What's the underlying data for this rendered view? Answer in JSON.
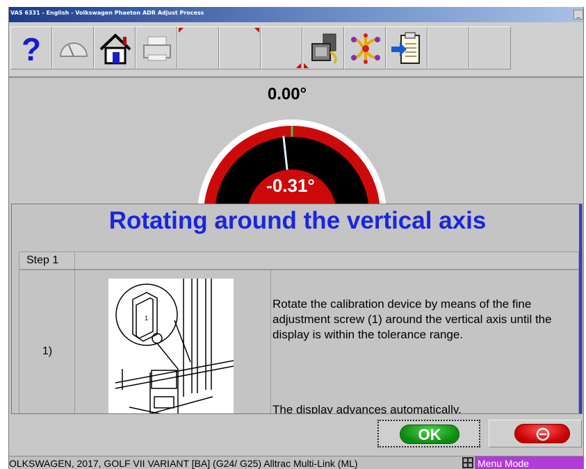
{
  "window": {
    "title": "VAS 6331 - English - Volkswagen Phaeton ADR Adjust Process",
    "minimize_label": "_"
  },
  "toolbar": {
    "buttons": [
      {
        "icon": "help-icon"
      },
      {
        "icon": "gauge-icon"
      },
      {
        "icon": "home-icon"
      },
      {
        "icon": "printer-icon"
      },
      {
        "icon": "empty"
      },
      {
        "icon": "empty"
      },
      {
        "icon": "empty"
      },
      {
        "icon": "diagnosis-device-icon"
      },
      {
        "icon": "circuit-icon"
      },
      {
        "icon": "clipboard-import-icon"
      },
      {
        "icon": "empty"
      },
      {
        "icon": "empty"
      }
    ]
  },
  "gauge": {
    "target_angle": "0.00°",
    "measured_angle": "-0.31°",
    "measured_value": -0.31,
    "colors": {
      "band": "#cc0a0a",
      "face": "#000000",
      "needle": "#d8f0ff",
      "marker": "#3cc83c"
    }
  },
  "panel": {
    "title": "Rotating around the vertical axis",
    "step_label": "Step 1",
    "step_number": "1)",
    "instruction": "Rotate the calibration device by means of the fine adjustment screw (1) around the vertical axis until the display is within the tolerance range.",
    "instruction_secondary": "The display advances automatically.",
    "title_color": "#1a25e0"
  },
  "buttons": {
    "ok_label": "OK",
    "cancel_icon": "no-entry-icon"
  },
  "status": {
    "vehicle": "OLKSWAGEN, 2017, GOLF VII VARIANT [BA] (G24/ G25) Alltrac Multi-Link (ML)",
    "mode": "Menu Mode",
    "mode_color": "#b03bd6"
  }
}
